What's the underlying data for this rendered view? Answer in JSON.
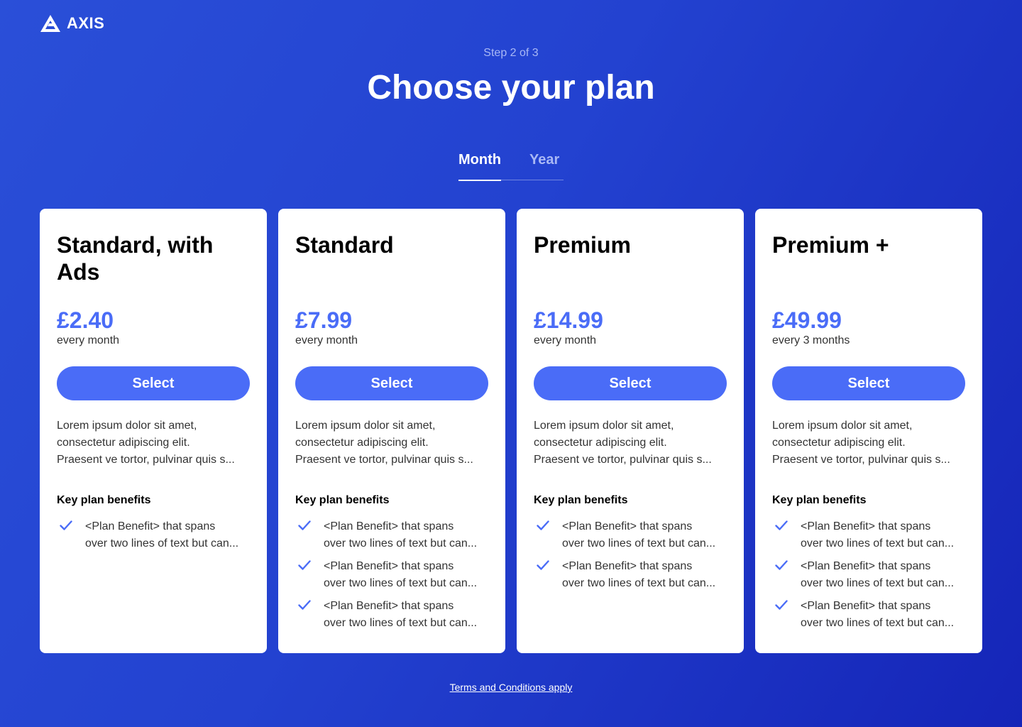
{
  "brand": {
    "name": "AXIS",
    "logo_icon": "axis-triangle-logo"
  },
  "header": {
    "step": "Step 2 of 3",
    "title": "Choose your plan"
  },
  "tabs": [
    {
      "label": "Month",
      "active": true
    },
    {
      "label": "Year",
      "active": false
    }
  ],
  "colors": {
    "accent": "#4a6cf7",
    "background": "#2342d0",
    "card": "#ffffff"
  },
  "plans": [
    {
      "name": "Standard, with Ads",
      "price": "£2.40",
      "period": "every month",
      "button": "Select",
      "description": [
        "Lorem ipsum dolor sit amet,",
        "consectetur adipiscing elit.",
        "Praesent ve tortor, pulvinar quis s..."
      ],
      "benefits_title": "Key plan benefits",
      "benefits": [
        {
          "line1": "<Plan Benefit> that spans",
          "line2": "over two lines of text but can..."
        }
      ]
    },
    {
      "name": "Standard",
      "price": "£7.99",
      "period": "every month",
      "button": "Select",
      "description": [
        "Lorem ipsum dolor sit amet,",
        "consectetur adipiscing elit.",
        "Praesent ve tortor, pulvinar quis s..."
      ],
      "benefits_title": "Key plan benefits",
      "benefits": [
        {
          "line1": "<Plan Benefit> that spans",
          "line2": "over two lines of text but can..."
        },
        {
          "line1": "<Plan Benefit> that spans",
          "line2": "over two lines of text but can..."
        },
        {
          "line1": "<Plan Benefit> that spans",
          "line2": "over two lines of text but can..."
        }
      ]
    },
    {
      "name": "Premium",
      "price": "£14.99",
      "period": "every month",
      "button": "Select",
      "description": [
        "Lorem ipsum dolor sit amet,",
        "consectetur adipiscing elit.",
        "Praesent ve tortor, pulvinar quis s..."
      ],
      "benefits_title": "Key plan benefits",
      "benefits": [
        {
          "line1": "<Plan Benefit> that spans",
          "line2": "over two lines of text but can..."
        },
        {
          "line1": "<Plan Benefit> that spans",
          "line2": "over two lines of text but can..."
        }
      ]
    },
    {
      "name": "Premium +",
      "price": "£49.99",
      "period": "every 3 months",
      "button": "Select",
      "description": [
        "Lorem ipsum dolor sit amet,",
        "consectetur adipiscing elit.",
        "Praesent ve tortor, pulvinar quis s..."
      ],
      "benefits_title": "Key plan benefits",
      "benefits": [
        {
          "line1": "<Plan Benefit> that spans",
          "line2": "over two lines of text but can..."
        },
        {
          "line1": "<Plan Benefit> that spans",
          "line2": "over two lines of text but can..."
        },
        {
          "line1": "<Plan Benefit> that spans",
          "line2": "over two lines of text but can..."
        }
      ]
    }
  ],
  "footer": {
    "terms_link": "Terms and Conditions apply"
  }
}
